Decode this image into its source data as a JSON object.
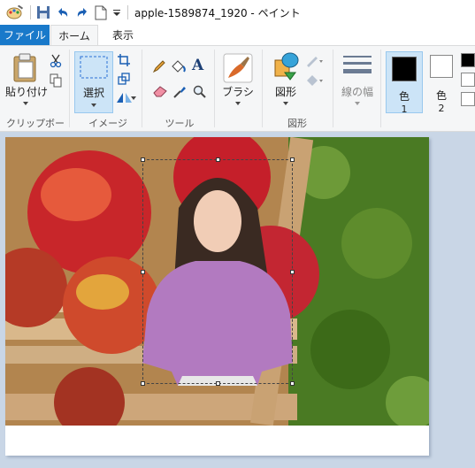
{
  "window": {
    "title": "apple-1589874_1920 - ペイント"
  },
  "quick_access": {
    "icons": [
      "paint-app-icon",
      "save-icon",
      "undo-icon",
      "redo-icon",
      "new-file-icon",
      "customize-arrow-icon"
    ]
  },
  "tabs": {
    "file": "ファイル",
    "home": "ホーム",
    "view": "表示"
  },
  "ribbon": {
    "clipboard": {
      "paste_label": "貼り付け",
      "group_label": "クリップボード"
    },
    "image": {
      "select_label": "選択",
      "group_label": "イメージ"
    },
    "tools": {
      "group_label": "ツール"
    },
    "brush": {
      "label": "ブラシ"
    },
    "shapes": {
      "label": "図形",
      "group_label": "図形"
    },
    "line_width": {
      "label": "線の幅"
    },
    "colors": {
      "color1_label": "色",
      "color1_num": "1",
      "color2_label": "色",
      "color2_num": "2",
      "color1": "#000000",
      "color2": "#ffffff"
    }
  },
  "accent": {
    "file_tab": "#1979ca",
    "selected_button": "#cce4f7"
  }
}
